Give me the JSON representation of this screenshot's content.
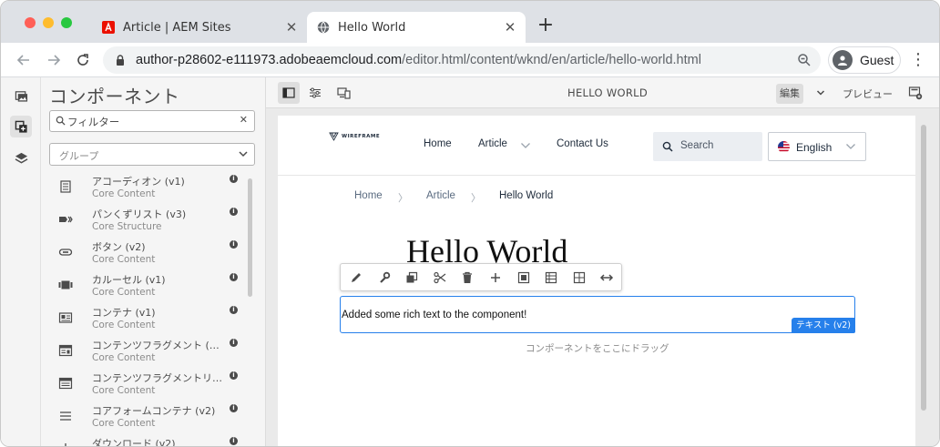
{
  "browser": {
    "tabs": [
      {
        "title": "Article | AEM Sites",
        "active": false,
        "favicon": "adobe-icon"
      },
      {
        "title": "Hello World",
        "active": true,
        "favicon": "globe-icon"
      }
    ],
    "close_glyph": "✕",
    "newtab_glyph": "+",
    "url_host": "author-p28602-e111973.adobeaemcloud.com",
    "url_path": "/editor.html/content/wknd/en/article/hello-world.html",
    "profile_name": "Guest",
    "menu_glyph": "⋮"
  },
  "rail": {
    "items": [
      "assets-icon",
      "components-icon",
      "layers-icon"
    ],
    "selected": "components-icon"
  },
  "panel": {
    "title": "コンポーネント",
    "filter_value": "フィルター",
    "filter_clear": "✕",
    "group_placeholder": "グループ",
    "components": [
      {
        "name": "アコーディオン (v1)",
        "group": "Core Content",
        "icon": "accordion-icon"
      },
      {
        "name": "パンくずリスト (v3)",
        "group": "Core Structure",
        "icon": "breadcrumb-icon"
      },
      {
        "name": "ボタン (v2)",
        "group": "Core Content",
        "icon": "button-icon"
      },
      {
        "name": "カルーセル (v1)",
        "group": "Core Content",
        "icon": "carousel-icon"
      },
      {
        "name": "コンテナ (v1)",
        "group": "Core Content",
        "icon": "container-icon"
      },
      {
        "name": "コンテンツフラグメント (…",
        "group": "Core Content",
        "icon": "content-fragment-icon"
      },
      {
        "name": "コンテンツフラグメントリ…",
        "group": "Core Content",
        "icon": "content-fragment-list-icon"
      },
      {
        "name": "コアフォームコンテナ (v2)",
        "group": "Core Content",
        "icon": "form-container-icon"
      },
      {
        "name": "ダウンロード (v2)",
        "group": "",
        "icon": "download-icon"
      }
    ],
    "info_glyph": "i"
  },
  "editor": {
    "page_title": "HELLO WORLD",
    "mode": "編集",
    "preview": "プレビュー"
  },
  "site": {
    "logo_text": "WIREFRAME",
    "nav": [
      "Home",
      "Article",
      "Contact Us"
    ],
    "search_placeholder": "Search",
    "language": "English",
    "breadcrumb": [
      "Home",
      "Article",
      "Hello World"
    ],
    "breadcrumb_sep": "〉",
    "heading": "Hello World",
    "text_content": "Added some rich text to the component!",
    "component_badge": "テキスト (v2)",
    "dropzone_hint": "コンポーネントをここにドラッグ"
  },
  "component_toolbar": [
    "edit-icon",
    "configure-icon",
    "copy-icon",
    "cut-icon",
    "delete-icon",
    "insert-icon",
    "group-icon",
    "parent-icon",
    "layout-icon",
    "resize-icon"
  ],
  "colors": {
    "accent_blue": "#2680eb",
    "tab_strip": "#dee1e6",
    "panel_bg": "#f5f5f5"
  }
}
